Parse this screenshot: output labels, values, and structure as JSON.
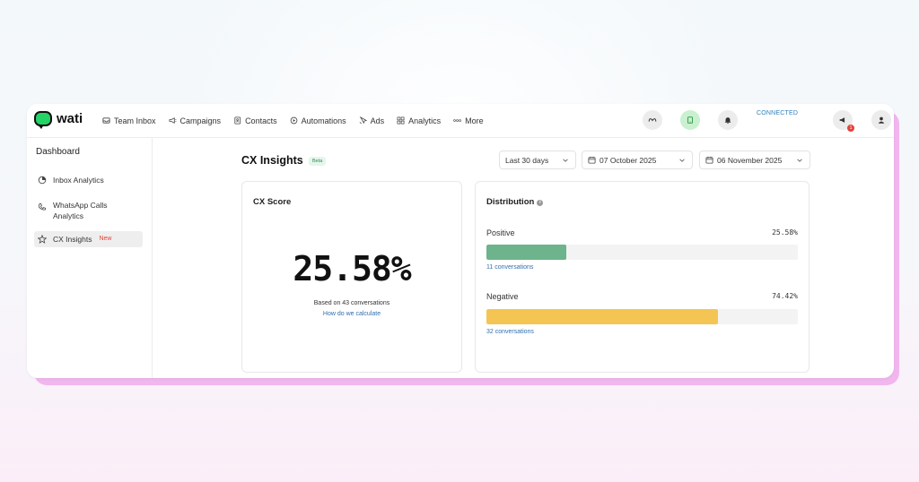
{
  "app": {
    "logo_text": "wati"
  },
  "nav": [
    {
      "id": "team-inbox",
      "label": "Team Inbox",
      "icon": "inbox-icon"
    },
    {
      "id": "campaigns",
      "label": "Campaigns",
      "icon": "megaphone-icon"
    },
    {
      "id": "contacts",
      "label": "Contacts",
      "icon": "contacts-icon"
    },
    {
      "id": "automations",
      "label": "Automations",
      "icon": "automation-icon"
    },
    {
      "id": "ads",
      "label": "Ads",
      "icon": "ads-icon"
    },
    {
      "id": "analytics",
      "label": "Analytics",
      "icon": "grid-icon"
    },
    {
      "id": "more",
      "label": "More",
      "icon": "dots-icon"
    }
  ],
  "header": {
    "connected_label": "CONNECTED",
    "notification_badge": "1",
    "accent_green": "#25d366"
  },
  "sidebar": {
    "title": "Dashboard",
    "items": [
      {
        "label": "Inbox Analytics",
        "icon": "pie-chart-icon"
      },
      {
        "label": "WhatsApp Calls Analytics",
        "icon": "phone-icon"
      },
      {
        "label": "CX Insights",
        "icon": "star-icon",
        "tag": "New",
        "active": true
      }
    ]
  },
  "main": {
    "title": "CX Insights",
    "beta_label": "Beta",
    "range_select": "Last 30 days",
    "start_date": "07 October 2025",
    "end_date": "06 November 2025"
  },
  "cx_score": {
    "title": "CX Score",
    "value": "25.58%",
    "based_on": "Based on 43 conversations",
    "calc_link": "How do we calculate"
  },
  "distribution": {
    "title": "Distribution",
    "rows": [
      {
        "label": "Positive",
        "percent_text": "25.58%",
        "percent": 25.58,
        "color": "#6db38b",
        "conversations": "11 conversations"
      },
      {
        "label": "Negative",
        "percent_text": "74.42%",
        "percent": 74.42,
        "color": "#f5c553",
        "conversations": "32 conversations"
      }
    ]
  }
}
